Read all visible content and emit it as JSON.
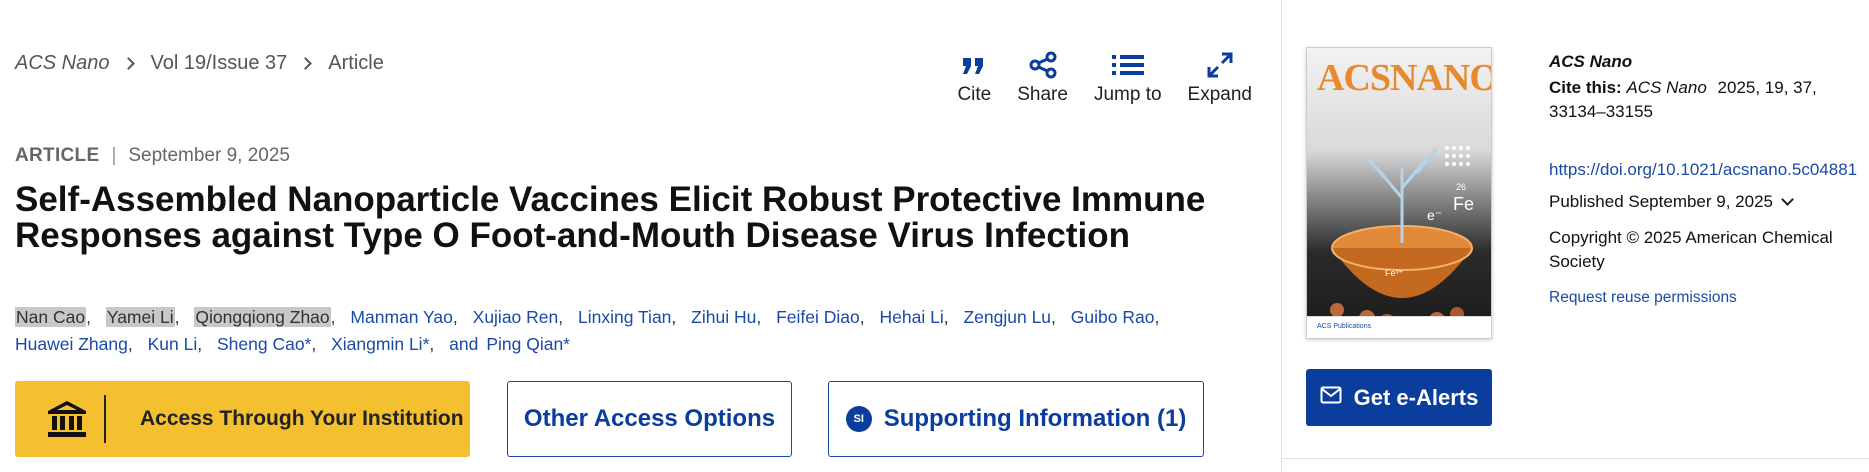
{
  "breadcrumb": {
    "journal": "ACS Nano",
    "issue": "Vol 19/Issue 37",
    "current": "Article"
  },
  "toolbar": {
    "cite": "Cite",
    "share": "Share",
    "jump": "Jump to",
    "expand": "Expand"
  },
  "article": {
    "type": "ARTICLE",
    "separator": "|",
    "date": "September 9, 2025",
    "title": "Self-Assembled Nanoparticle Vaccines Elicit Robust Protective Immune Responses against Type O Foot-and-Mouth Disease Virus Infection",
    "authors": [
      "Nan Cao",
      "Yamei Li",
      "Qiongqiong Zhao",
      "Manman Yao",
      "Xujiao Ren",
      "Linxing Tian",
      "Zihui Hu",
      "Feifei Diao",
      "Hehai Li",
      "Zengjun Lu",
      "Guibo Rao",
      "Huawei Zhang",
      "Kun Li",
      "Sheng Cao*",
      "Xiangmin Li*"
    ],
    "and_label": "and",
    "last_author": "Ping Qian*"
  },
  "buttons": {
    "institution": "Access Through Your Institution",
    "other": "Other Access Options",
    "si_badge": "SI",
    "supporting": "Supporting Information (1)"
  },
  "sidebar": {
    "journal": "ACS Nano",
    "cite_label": "Cite this:",
    "cite_journal": "ACS Nano",
    "cite_ref": "2025, 19, 37, 33134–33155",
    "doi": "https://doi.org/10.1021/acsnano.5c04881",
    "published": "Published September 9, 2025",
    "copyright": "Copyright © 2025 American Chemical Society",
    "reuse": "Request reuse permissions",
    "alerts": "Get e-Alerts",
    "cover_title": "ACSNANO",
    "cover_footer": "ACS Publications",
    "cover_fe": "Fe",
    "cover_e": "e⁻",
    "cover_fe3": "Fe³⁺",
    "cover_26": "26"
  },
  "colors": {
    "link": "#1a4aa8",
    "accent": "#0b3d9c",
    "institution_button": "#f5c02f",
    "author_highlight": "#c8c8c8"
  },
  "icons": {
    "cite": "quote-icon",
    "share": "share-icon",
    "jump": "list-icon",
    "expand": "expand-icon",
    "institution": "bank-icon",
    "alerts": "mail-icon"
  }
}
